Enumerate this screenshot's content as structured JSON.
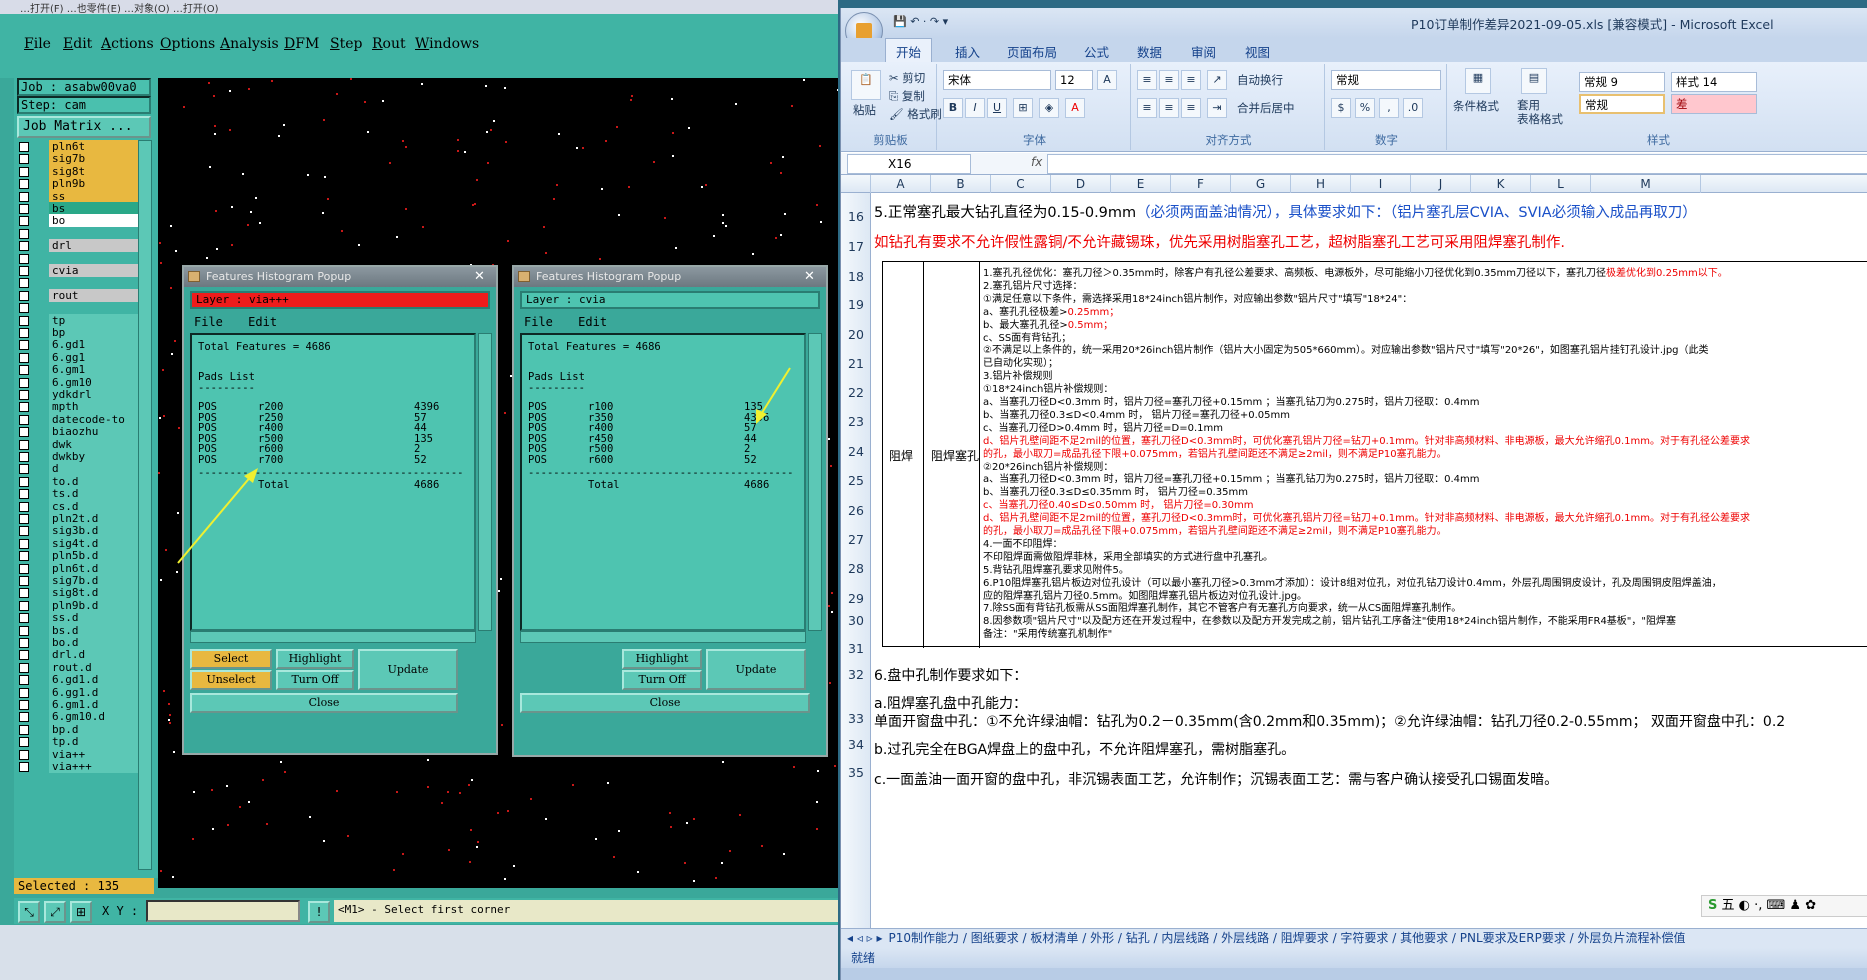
{
  "cam": {
    "topstrip": "…打开(F)      …也零件(E)      …对象(O)         …打开(O)",
    "menu": [
      "File",
      "Edit",
      "Actions",
      "Options",
      "Analysis",
      "DFM",
      "Step",
      "Rout",
      "Windows"
    ],
    "job": "Job : asabw00va0",
    "step": "Step: cam",
    "job_matrix": "Job Matrix ...",
    "layers": [
      {
        "name": "pln6t",
        "color": "#e8b840"
      },
      {
        "name": "sig7b",
        "color": "#e8b840"
      },
      {
        "name": "sig8t",
        "color": "#e8b840"
      },
      {
        "name": "pln9b",
        "color": "#e8b840"
      },
      {
        "name": "ss",
        "color": "#e8b840"
      },
      {
        "name": "bs",
        "color": "#2aa888"
      },
      {
        "name": "bo",
        "color": "#ffffff"
      },
      {
        "name": "",
        "color": ""
      },
      {
        "name": "drl",
        "color": "#c8c8c8"
      },
      {
        "name": "",
        "color": ""
      },
      {
        "name": "cvia",
        "color": "#c8c8c8"
      },
      {
        "name": "",
        "color": ""
      },
      {
        "name": "rout",
        "color": "#c8c8c8"
      },
      {
        "name": "",
        "color": ""
      },
      {
        "name": "tp",
        "color": "#5cc8b6"
      },
      {
        "name": "bp",
        "color": "#5cc8b6"
      },
      {
        "name": "6.gd1",
        "color": "#5cc8b6"
      },
      {
        "name": "6.gg1",
        "color": "#5cc8b6"
      },
      {
        "name": "6.gm1",
        "color": "#5cc8b6"
      },
      {
        "name": "6.gm10",
        "color": "#5cc8b6"
      },
      {
        "name": "ydkdrl",
        "color": "#5cc8b6"
      },
      {
        "name": "mpth",
        "color": "#5cc8b6"
      },
      {
        "name": "datecode-to",
        "color": "#5cc8b6"
      },
      {
        "name": "biaozhu",
        "color": "#5cc8b6"
      },
      {
        "name": "dwk",
        "color": "#5cc8b6"
      },
      {
        "name": "dwkby",
        "color": "#5cc8b6"
      },
      {
        "name": "d",
        "color": "#5cc8b6"
      },
      {
        "name": "to.d",
        "color": "#5cc8b6"
      },
      {
        "name": "ts.d",
        "color": "#5cc8b6"
      },
      {
        "name": "cs.d",
        "color": "#5cc8b6"
      },
      {
        "name": "pln2t.d",
        "color": "#5cc8b6"
      },
      {
        "name": "sig3b.d",
        "color": "#5cc8b6"
      },
      {
        "name": "sig4t.d",
        "color": "#5cc8b6"
      },
      {
        "name": "pln5b.d",
        "color": "#5cc8b6"
      },
      {
        "name": "pln6t.d",
        "color": "#5cc8b6"
      },
      {
        "name": "sig7b.d",
        "color": "#5cc8b6"
      },
      {
        "name": "sig8t.d",
        "color": "#5cc8b6"
      },
      {
        "name": "pln9b.d",
        "color": "#5cc8b6"
      },
      {
        "name": "ss.d",
        "color": "#5cc8b6"
      },
      {
        "name": "bs.d",
        "color": "#5cc8b6"
      },
      {
        "name": "bo.d",
        "color": "#5cc8b6"
      },
      {
        "name": "drl.d",
        "color": "#5cc8b6"
      },
      {
        "name": "rout.d",
        "color": "#5cc8b6"
      },
      {
        "name": "6.gd1.d",
        "color": "#5cc8b6"
      },
      {
        "name": "6.gg1.d",
        "color": "#5cc8b6"
      },
      {
        "name": "6.gm1.d",
        "color": "#5cc8b6"
      },
      {
        "name": "6.gm10.d",
        "color": "#5cc8b6"
      },
      {
        "name": "bp.d",
        "color": "#5cc8b6"
      },
      {
        "name": "tp.d",
        "color": "#5cc8b6"
      },
      {
        "name": "via++",
        "color": "#5cc8b6"
      },
      {
        "name": "via+++",
        "color": "#5cc8b6"
      }
    ],
    "selected": "Selected : 135",
    "xy_label": "X Y :",
    "prompt": "<M1> - Select first corner"
  },
  "popup1": {
    "title": "Features Histogram Popup",
    "layer": "Layer :  via+++",
    "menu_file": "File",
    "menu_edit": "Edit",
    "total": "Total Features = 4686",
    "list_title": "Pads List",
    "rows": [
      {
        "type": "POS",
        "sym": "r200",
        "count": "4396"
      },
      {
        "type": "POS",
        "sym": "r250",
        "count": "57"
      },
      {
        "type": "POS",
        "sym": "r400",
        "count": "44"
      },
      {
        "type": "POS",
        "sym": "r500",
        "count": "135"
      },
      {
        "type": "POS",
        "sym": "r600",
        "count": "2"
      },
      {
        "type": "POS",
        "sym": "r700",
        "count": "52"
      }
    ],
    "total_label": "Total",
    "total_value": "4686",
    "btn_select": "Select",
    "btn_unselect": "Unselect",
    "btn_highlight": "Highlight",
    "btn_turnoff": "Turn Off",
    "btn_update": "Update",
    "btn_close": "Close"
  },
  "popup2": {
    "title": "Features Histogram Popup",
    "layer": "Layer :  cvia",
    "menu_file": "File",
    "menu_edit": "Edit",
    "total": "Total Features = 4686",
    "list_title": "Pads List",
    "rows": [
      {
        "type": "POS",
        "sym": "r100",
        "count": "135"
      },
      {
        "type": "POS",
        "sym": "r350",
        "count": "4396"
      },
      {
        "type": "POS",
        "sym": "r400",
        "count": "57"
      },
      {
        "type": "POS",
        "sym": "r450",
        "count": "44"
      },
      {
        "type": "POS",
        "sym": "r500",
        "count": "2"
      },
      {
        "type": "POS",
        "sym": "r600",
        "count": "52"
      }
    ],
    "total_label": "Total",
    "total_value": "4686",
    "btn_highlight": "Highlight",
    "btn_turnoff": "Turn Off",
    "btn_update": "Update",
    "btn_close": "Close"
  },
  "excel": {
    "title": "P10订单制作差异2021-09-05.xls  [兼容模式] - Microsoft Excel",
    "tabs": [
      "开始",
      "插入",
      "页面布局",
      "公式",
      "数据",
      "审阅",
      "视图"
    ],
    "clipboard": {
      "paste": "粘贴",
      "cut": "剪切",
      "copy": "复制",
      "format_painter": "格式刷",
      "group": "剪贴板"
    },
    "font": {
      "name": "宋体",
      "size": "12",
      "group": "字体"
    },
    "align": {
      "wrap": "自动换行",
      "merge": "合并后居中",
      "group": "对齐方式"
    },
    "number": {
      "format": "常规",
      "group": "数字"
    },
    "styles": {
      "cond": "条件格式",
      "table": "套用\n表格格式",
      "s1": "常规 9",
      "s2": "样式 14",
      "s3": "常规",
      "s4": "差",
      "group": "样式"
    },
    "namebox": "X16",
    "fx": "fx",
    "columns": [
      "A",
      "B",
      "C",
      "D",
      "E",
      "F",
      "G",
      "H",
      "I",
      "J",
      "K",
      "L",
      "M"
    ],
    "rows": [
      "16",
      "17",
      "18",
      "19",
      "20",
      "21",
      "22",
      "23",
      "24",
      "25",
      "26",
      "27",
      "28",
      "29",
      "30",
      "31",
      "32",
      "33",
      "34",
      "35"
    ],
    "r16a": "5.正常塞孔最大钻孔直径为0.15-0.9mm",
    "r16b": "（必须两面盖油情况），具体要求如下：（铝片塞孔层CVIA、SVIA必须输入成品再取刀）",
    "r17": "如钻孔有要求不允许假性露铜/不允许藏锡珠，优先采用树脂塞孔工艺，超树脂塞孔工艺可采用阻焊塞孔制作.",
    "cat1": "阻焊",
    "cat2": "阻焊塞孔",
    "lines": [
      {
        "t": "1.塞孔孔径优化：塞孔刀径＞0.35mm时，除客户有孔径公差要求、高频板、电源板外，尽可能缩小刀径优化到0.35mm刀径以下，塞孔刀径",
        "r": "极差优化到0.25mm以下。",
        "c": ""
      },
      {
        "t": "2.塞孔铝片尺寸选择：",
        "r": "",
        "c": ""
      },
      {
        "t": "①满足任意以下条件，需选择采用18*24inch铝片制作，对应输出参数\"铝片尺寸\"填写\"18*24\"：",
        "r": "",
        "c": ""
      },
      {
        "t": "a、塞孔孔径极差>",
        "r": "0.25mm；",
        "c": ""
      },
      {
        "t": "b、最大塞孔孔径>",
        "r": "0.5mm；",
        "c": ""
      },
      {
        "t": "c、SS面有背钻孔；",
        "r": "",
        "c": ""
      },
      {
        "t": "②不满足以上条件的，统一采用20*26inch铝片制作（铝片大小固定为505*660mm）。对应输出参数\"铝片尺寸\"填写\"20*26\"，如图塞孔铝片挂钉孔设计.jpg（此类",
        "r": "",
        "c": ""
      },
      {
        "t": "已自动化实现）；",
        "r": "",
        "c": ""
      },
      {
        "t": "3.铝片补偿规则",
        "r": "",
        "c": ""
      },
      {
        "t": "①18*24inch铝片补偿规则：",
        "r": "",
        "c": ""
      },
      {
        "t": "a、当塞孔刀径D<0.3mm 时，铝片刀径=塞孔刀径+0.15mm ；当塞孔钻刀为0.275时，铝片刀径取：0.4mm",
        "r": "",
        "c": ""
      },
      {
        "t": "b、当塞孔刀径0.3≤D<0.4mm 时， 铝片刀径=塞孔刀径+0.05mm",
        "r": "",
        "c": ""
      },
      {
        "t": "c、当塞孔刀径D>0.4mm 时，铝片刀径=D=0.1mm",
        "r": "",
        "c": ""
      },
      {
        "t": "",
        "r": "d、铝片孔壁间距不足2mil的位置，塞孔刀径D<0.3mm时，可优化塞孔铝片刀径=钻刀+0.1mm。针对非高频材料、非电源板，最大允许缩孔0.1mm。对于有孔径公差要求",
        "c": ""
      },
      {
        "t": "",
        "r": "的孔，最小取刀=成品孔径下限+0.075mm，若铝片孔壁间距还不满足≥2mil，则不满足P10塞孔能力。",
        "c": ""
      },
      {
        "t": "②20*26inch铝片补偿规则：",
        "r": "",
        "c": ""
      },
      {
        "t": "a、当塞孔刀径D<0.3mm 时，铝片刀径=塞孔刀径+0.15mm ；当塞孔钻刀为0.275时，铝片刀径取：0.4mm",
        "r": "",
        "c": ""
      },
      {
        "t": "b、当塞孔刀径0.3≤D≤0.35mm 时， 铝片刀径=0.35mm",
        "r": "",
        "c": ""
      },
      {
        "t": "",
        "r": "c、当塞孔刀径0.40≤D≤0.50mm 时， 铝片刀径=0.30mm",
        "c": ""
      },
      {
        "t": "",
        "r": "d、铝片孔壁间距不足2mil的位置，塞孔刀径D<0.3mm时，可优化塞孔铝片刀径=钻刀+0.1mm。针对非高频材料、非电源板，最大允许缩孔0.1mm。对于有孔径公差要求",
        "c": ""
      },
      {
        "t": "",
        "r": "的孔，最小取刀=成品孔径下限+0.075mm，若铝片孔壁间距还不满足≥2mil，则不满足P10塞孔能力。",
        "c": ""
      },
      {
        "t": "4.一面不印阻焊：",
        "r": "",
        "c": ""
      },
      {
        "t": "不印阻焊面需做阻焊菲林，采用全部填实的方式进行盘中孔塞孔。",
        "r": "",
        "c": ""
      },
      {
        "t": "5.背钻孔阻焊塞孔要求见附件5。",
        "r": "",
        "c": ""
      },
      {
        "t": "6.P10阻焊塞孔铝片板边对位孔设计（可以最小塞孔刀径>0.3mm才添加）：设计8组对位孔，对位孔钻刀设计0.4mm，外层孔周围铜皮设计，孔及周围铜皮阻焊盖油，",
        "r": "",
        "c": ""
      },
      {
        "t": "应的阻焊塞孔铝片刀径0.5mm。如图阻焊塞孔铝片板边对位孔设计.jpg。",
        "r": "",
        "c": ""
      },
      {
        "t": "7.除SS面有背钻孔板需从SS面阻焊塞孔制作，其它不管客户有无塞孔方向要求，统一从CS面阻焊塞孔制作。",
        "r": "",
        "c": ""
      },
      {
        "t": "8.因参数项\"铝片尺寸\"以及配方还在开发过程中，在参数以及配方开发完成之前，铝片钻孔工序备注\"使用18*24inch铝片制作，不能采用FR4基板\"，\"阻焊塞",
        "r": "",
        "c": ""
      },
      {
        "t": "备注：\"采用传统塞孔机制作\"",
        "r": "",
        "c": ""
      }
    ],
    "r32": "6.盘中孔制作要求如下：",
    "r33a": "a.阻焊塞孔盘中孔能力：",
    "r33b": "单面开窗盘中孔：①不允许绿油帽：钻孔为0.2－0.35mm(含0.2mm和0.35mm)；②允许绿油帽：钻孔刀径0.2-0.55mm；     双面开窗盘中孔：0.2",
    "r34": "b.过孔完全在BGA焊盘上的盘中孔，不允许阻焊塞孔，需树脂塞孔。",
    "r35": "c.一面盖油一面开窗的盘中孔，非沉锡表面工艺，允许制作；沉锡表面工艺：需与客户确认接受孔口锡面发暗。",
    "sheettabs": "P10制作能力 / 图纸要求 / 板材清单 / 外形 / 钻孔 / 内层线路 / 外层线路 / 阻焊要求 / 字符要求 / 其他要求 / PNL要求及ERP要求 / 外层负片流程补偿值",
    "status": "就绪",
    "ime": "五"
  }
}
